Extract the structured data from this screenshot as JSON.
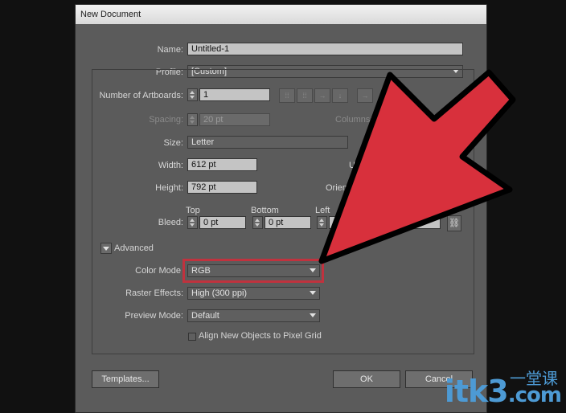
{
  "dialog": {
    "title": "New Document",
    "name_label": "Name:",
    "name_value": "Untitled-1",
    "profile_label": "Profile:",
    "profile_value": "[Custom]",
    "artboards_label": "Number of Artboards:",
    "artboards_value": "1",
    "spacing_label": "Spacing:",
    "spacing_value": "20 pt",
    "columns_label": "Columns:",
    "size_label": "Size:",
    "size_value": "Letter",
    "width_label": "Width:",
    "width_value": "612 pt",
    "units_label": "U",
    "height_label": "Height:",
    "height_value": "792 pt",
    "orientation_label": "Orient",
    "bleed_label": "Bleed:",
    "bleed_top_label": "Top",
    "bleed_top_value": "0 pt",
    "bleed_bottom_label": "Bottom",
    "bleed_bottom_value": "0 pt",
    "bleed_left_label": "Left",
    "advanced_label": "Advanced",
    "color_mode_label": "Color Mode",
    "color_mode_value": "RGB",
    "raster_label": "Raster Effects:",
    "raster_value": "High (300 ppi)",
    "preview_label": "Preview Mode:",
    "preview_value": "Default",
    "align_label": "Align New Objects to Pixel Grid",
    "templates_button": "Templates...",
    "ok_button": "OK",
    "cancel_button": "Cancel"
  },
  "watermark": {
    "text": "itk3",
    "sub": "一堂课",
    "domain": ".com"
  },
  "colors": {
    "arrow_fill": "#d8303c",
    "arrow_outline": "#000000",
    "highlight": "#c0323e",
    "watermark": "#4d9ad4"
  }
}
